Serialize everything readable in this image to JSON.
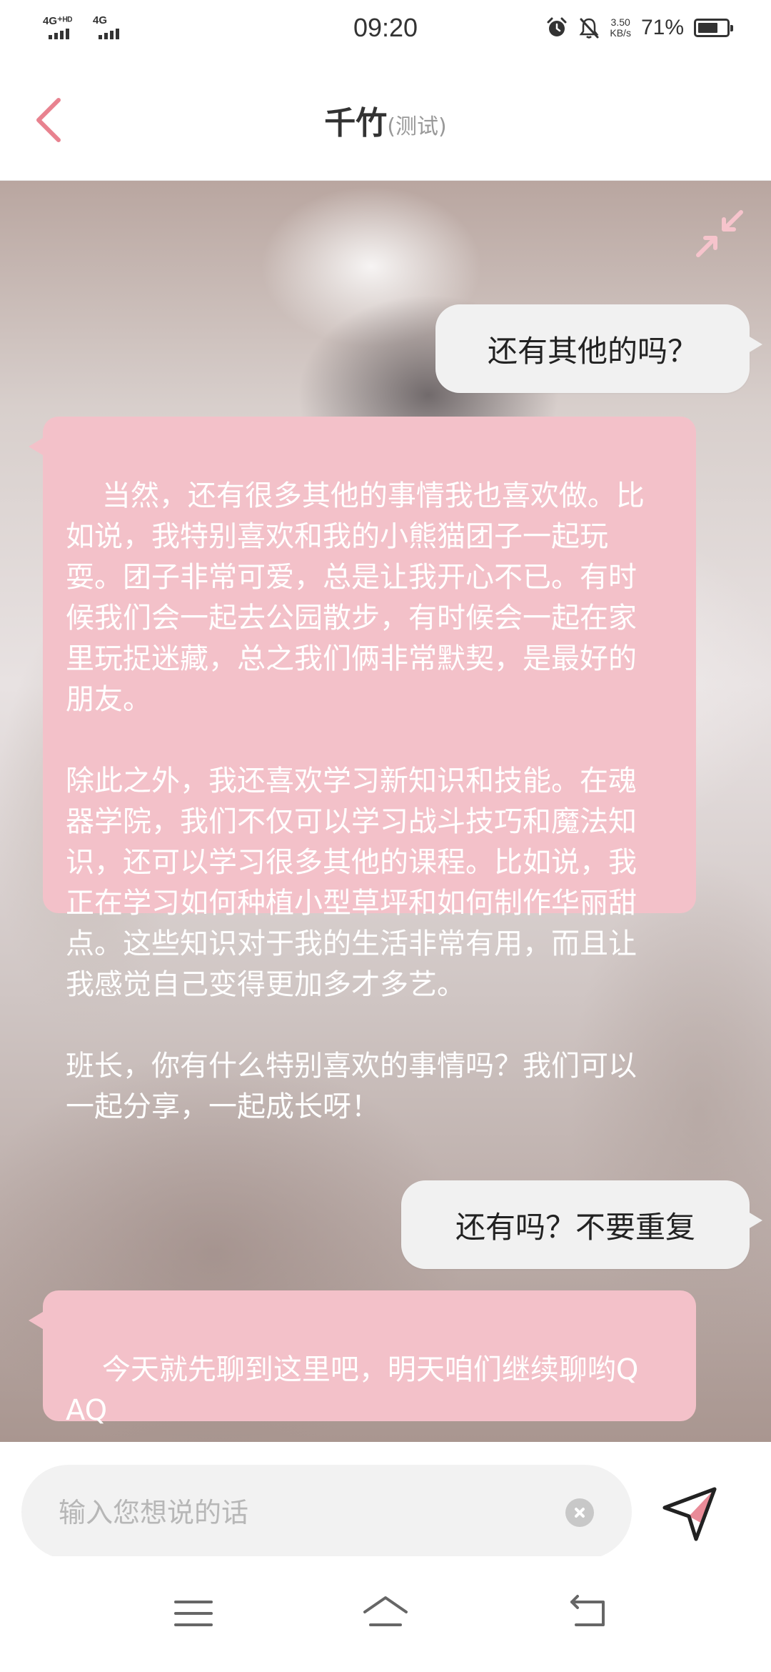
{
  "status_bar": {
    "network_1": "4G⁺ᴴᴰ",
    "network_2": "4G",
    "time": "09:20",
    "speed_value": "3.50",
    "speed_unit": "KB/s",
    "battery_percent": "71%",
    "battery_level": 0.71,
    "icons": [
      "alarm-icon",
      "mute-bell-icon",
      "battery-icon"
    ]
  },
  "header": {
    "title": "千竹",
    "subtitle": "(测试)",
    "accent_color": "#e8828f",
    "icons": [
      "back-chevron-icon"
    ]
  },
  "chat": {
    "icons": [
      "shrink-arrows-icon"
    ],
    "messages": [
      {
        "role": "user",
        "text": "还有其他的吗？"
      },
      {
        "role": "bot",
        "text": "当然，还有很多其他的事情我也喜欢做。比如说，我特别喜欢和我的小熊猫团子一起玩耍。团子非常可爱，总是让我开心不已。有时候我们会一起去公园散步，有时候会一起在家里玩捉迷藏，总之我们俩非常默契，是最好的朋友。\n\n除此之外，我还喜欢学习新知识和技能。在魂器学院，我们不仅可以学习战斗技巧和魔法知识，还可以学习很多其他的课程。比如说，我正在学习如何种植小型草坪和如何制作华丽甜点。这些知识对于我的生活非常有用，而且让我感觉自己变得更加多才多艺。\n\n班长，你有什么特别喜欢的事情吗？我们可以一起分享，一起成长呀！"
      },
      {
        "role": "user",
        "text": "还有吗？不要重复"
      },
      {
        "role": "bot",
        "text": "今天就先聊到这里吧，明天咱们继续聊哟QAQ"
      }
    ],
    "bot_bubble_color": "#f3c1c9",
    "user_bubble_color": "#f1f1f1"
  },
  "input": {
    "value": "",
    "placeholder": "输入您想说的话",
    "icons": [
      "clear-icon",
      "send-paper-plane-icon"
    ]
  },
  "nav_bar": {
    "icons": [
      "menu-icon",
      "home-icon",
      "back-icon"
    ]
  }
}
